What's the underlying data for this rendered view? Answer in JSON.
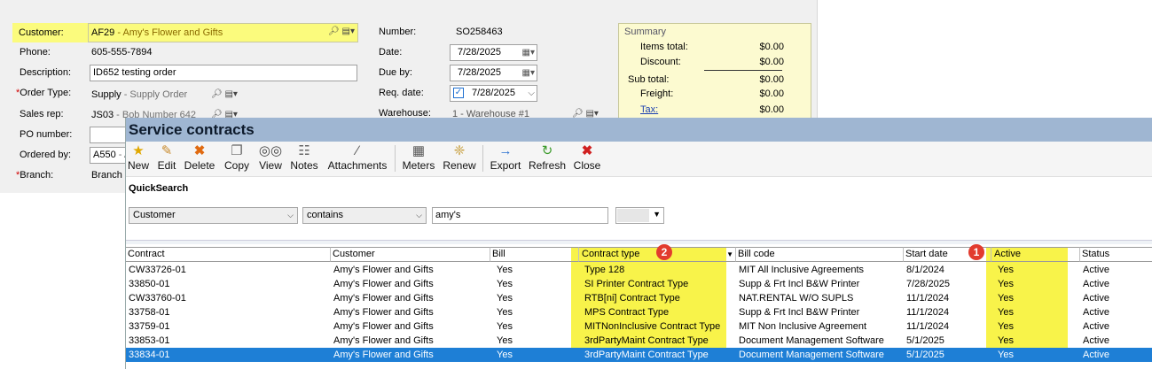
{
  "order_form": {
    "customer": {
      "label": "Customer:",
      "code": "AF29",
      "desc": " - Amy's Flower and Gifts"
    },
    "phone": {
      "label": "Phone:",
      "value": "605-555-7894"
    },
    "description": {
      "label": "Description:",
      "value": "ID652 testing order"
    },
    "order_type": {
      "label": "Order Type:",
      "code": "Supply",
      "desc": " - Supply Order"
    },
    "sales_rep": {
      "label": "Sales rep:",
      "code": "JS03",
      "desc": " - Bob Number 642"
    },
    "po_number": {
      "label": "PO number:",
      "value": ""
    },
    "ordered_by": {
      "label": "Ordered by:",
      "code": "A550",
      "desc": " - A"
    },
    "branch": {
      "label": "Branch:",
      "value": "Branch"
    },
    "number": {
      "label": "Number:",
      "value": "SO258463"
    },
    "date": {
      "label": "Date:",
      "value": "7/28/2025"
    },
    "due_by": {
      "label": "Due by:",
      "value": "7/28/2025"
    },
    "req_date": {
      "label": "Req. date:",
      "value": "7/28/2025"
    },
    "warehouse": {
      "label": "Warehouse:",
      "value": "1 - Warehouse #1"
    }
  },
  "summary": {
    "title": "Summary",
    "items_total": {
      "label": "Items total:",
      "value": "$0.00"
    },
    "discount": {
      "label": "Discount:",
      "value": "$0.00"
    },
    "sub_total": {
      "label": "Sub total:",
      "value": "$0.00"
    },
    "freight": {
      "label": "Freight:",
      "value": "$0.00"
    },
    "tax": {
      "label": "Tax:",
      "value": "$0.00"
    }
  },
  "service_contracts": {
    "title": "Service contracts",
    "toolbar": [
      {
        "label": "New",
        "icon": "star-icon"
      },
      {
        "label": "Edit",
        "icon": "pencil-icon"
      },
      {
        "label": "Delete",
        "icon": "delete-x-icon"
      },
      {
        "label": "Copy",
        "icon": "copy-icon"
      },
      {
        "label": "View",
        "icon": "binoculars-icon"
      },
      {
        "label": "Notes",
        "icon": "notes-icon"
      },
      {
        "label": "Attachments",
        "icon": "paperclip-icon"
      },
      {
        "label": "Meters",
        "icon": "meters-icon"
      },
      {
        "label": "Renew",
        "icon": "renew-icon"
      },
      {
        "label": "Export",
        "icon": "export-icon"
      },
      {
        "label": "Refresh",
        "icon": "refresh-icon"
      },
      {
        "label": "Close",
        "icon": "close-icon"
      }
    ],
    "quick_search": {
      "label": "QuickSearch",
      "field": "Customer",
      "operator": "contains",
      "value": "amy's"
    },
    "columns": [
      "Contract",
      "Customer",
      "Bill",
      "Contract type",
      "Bill code",
      "Start date",
      "Active",
      "Status"
    ],
    "rows": [
      [
        "CW33726-01",
        "Amy's Flower and Gifts",
        "Yes",
        "Type 128",
        "MIT All Inclusive Agreements",
        "8/1/2024",
        "Yes",
        "Active"
      ],
      [
        "33850-01",
        "Amy's Flower and Gifts",
        "Yes",
        "SI Printer Contract Type",
        "Supp & Frt Incl B&W Printer",
        "7/28/2025",
        "Yes",
        "Active"
      ],
      [
        "CW33760-01",
        "Amy's Flower and Gifts",
        "Yes",
        "RTB[ni] Contract Type",
        "NAT.RENTAL W/O SUPLS",
        "11/1/2024",
        "Yes",
        "Active"
      ],
      [
        "33758-01",
        "Amy's Flower and Gifts",
        "Yes",
        "MPS Contract Type",
        "Supp & Frt Incl B&W Printer",
        "11/1/2024",
        "Yes",
        "Active"
      ],
      [
        "33759-01",
        "Amy's Flower and Gifts",
        "Yes",
        "MITNonInclusive Contract Type",
        "MIT Non Inclusive Agreement",
        "11/1/2024",
        "Yes",
        "Active"
      ],
      [
        "33853-01",
        "Amy's Flower and Gifts",
        "Yes",
        "3rdPartyMaint Contract Type",
        "Document Management Software",
        "5/1/2025",
        "Yes",
        "Active"
      ],
      [
        "33834-01",
        "Amy's Flower and Gifts",
        "Yes",
        "3rdPartyMaint Contract Type",
        "Document Management Software",
        "5/1/2025",
        "Yes",
        "Active"
      ]
    ],
    "selected_row": 6,
    "annotations": [
      "1",
      "2"
    ],
    "colors": {
      "highlight": "#f8f34a",
      "selection": "#1e7fd6",
      "badge": "#e23b2e"
    }
  }
}
